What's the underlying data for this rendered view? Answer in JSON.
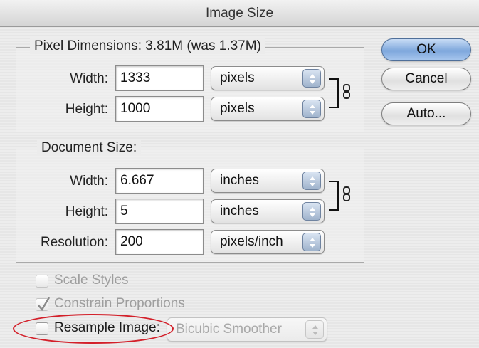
{
  "dialog": {
    "title": "Image Size"
  },
  "pixel_dimensions": {
    "legend": "Pixel Dimensions:  3.81M (was 1.37M)",
    "width_label": "Width:",
    "width_value": "1333",
    "width_unit": "pixels",
    "height_label": "Height:",
    "height_value": "1000",
    "height_unit": "pixels"
  },
  "document_size": {
    "legend": "Document Size:",
    "width_label": "Width:",
    "width_value": "6.667",
    "width_unit": "inches",
    "height_label": "Height:",
    "height_value": "5",
    "height_unit": "inches",
    "resolution_label": "Resolution:",
    "resolution_value": "200",
    "resolution_unit": "pixels/inch"
  },
  "buttons": {
    "ok": "OK",
    "cancel": "Cancel",
    "auto": "Auto..."
  },
  "options": {
    "scale_styles": {
      "label": "Scale Styles",
      "checked": false,
      "enabled": false
    },
    "constrain_proportions": {
      "label": "Constrain Proportions",
      "checked": true,
      "enabled": false
    },
    "resample_image": {
      "label": "Resample Image:",
      "checked": false,
      "enabled": true
    },
    "resample_method": "Bicubic Smoother"
  },
  "colors": {
    "highlight_oval": "#d3202a",
    "default_button": "#7ea7dc"
  },
  "icons": {
    "chain": "chain-link-icon",
    "popup_arrows": "up-down-arrows-icon",
    "checkmark": "checkmark-icon"
  }
}
